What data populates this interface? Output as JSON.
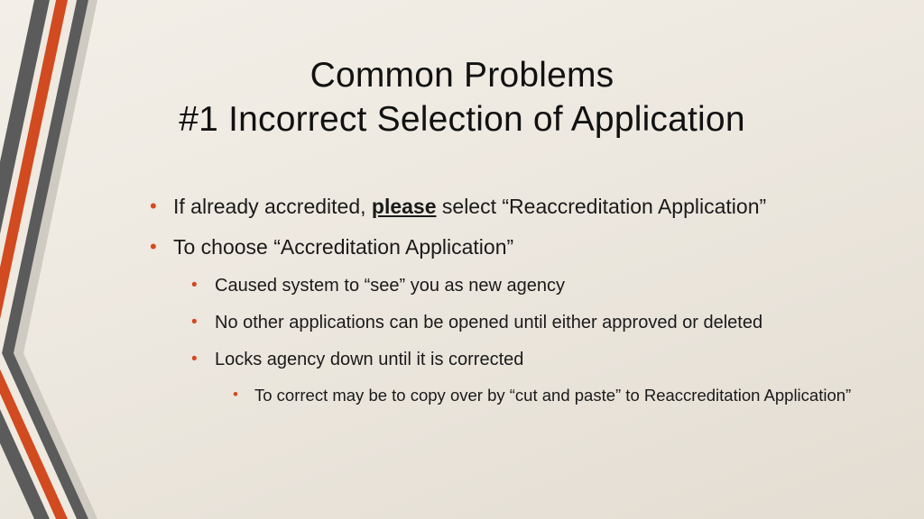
{
  "title": {
    "line1": "Common Problems",
    "line2": "#1 Incorrect Selection of Application"
  },
  "bullets": {
    "b1_pre": "If already accredited, ",
    "b1_emph": "please",
    "b1_post": " select “Reaccreditation Application”",
    "b2": "To choose “Accreditation Application”",
    "b2_1": "Caused system to “see” you as new agency",
    "b2_2": "No other applications can be opened until either approved or deleted",
    "b2_3": "Locks agency down until it is corrected",
    "b2_3_1": "To correct may be to copy over by “cut and paste” to Reaccreditation Application”"
  },
  "colors": {
    "accent": "#d24a1f",
    "gray": "#5b5b5b"
  }
}
